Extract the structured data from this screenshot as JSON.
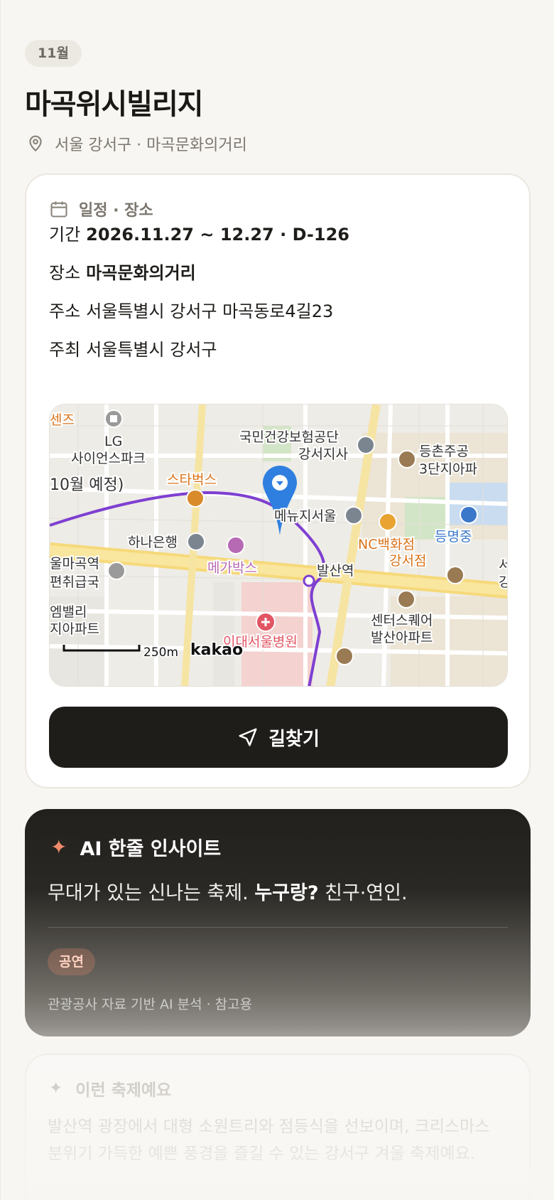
{
  "header": {
    "month": "11월",
    "title": "마곡위시빌리지",
    "location": "서울 강서구 · 마곡문화의거리"
  },
  "schedule": {
    "heading": "일정 · 장소",
    "period_label": "기간",
    "period_value": "2026.11.27 ~ 12.27 · D-126",
    "venue_label": "장소",
    "venue_value": "마곡문화의거리",
    "address_label": "주소",
    "address_value": "서울특별시 강서구 마곡동로4길23",
    "host_label": "주최",
    "host_value": "서울특별시 강서구"
  },
  "map": {
    "labels": {
      "lg1": "LG",
      "lg2": "사이언스파크",
      "topleft": "센즈",
      "oct": "10월 예정)",
      "starbucks": "스타벅스",
      "nhis1": "국민건강보험공단",
      "nhis2": "강서지사",
      "dc1": "등촌주공",
      "dc2": "3단지아파",
      "menuji": "메뉴지서울",
      "nc1": "NC백화점",
      "nc2": "강서점",
      "dm": "등명중",
      "hana": "하나은행",
      "mega": "메가박스",
      "balsan": "발산역",
      "ph1": "울마곡역",
      "ph2": "편취급국",
      "apt1": "엠밸리",
      "apt2": "지아파트",
      "center1": "센터스퀘어",
      "center2": "발산아파트",
      "hosp": "이대서울병원",
      "scale": "250m",
      "brand": "kakao",
      "edge1": "서",
      "edge2": "강"
    }
  },
  "directions_button": "길찾기",
  "ai": {
    "heading": "AI 한줄 인사이트",
    "line_plain": "무대가 있는 신나는 축제. ",
    "line_bold": "누구랑?",
    "line_tail": " 친구·연인.",
    "tag": "공연",
    "note": "관광공사 자료 기반 AI 분석 · 참고용"
  },
  "feature": {
    "heading": "이런 축제예요",
    "body": "발산역 광장에서 대형 소원트리와 점등식을 선보이며, 크리스마스 분위기 가득한 예쁜 풍경을 즐길 수 있는 강서구 겨울 축제예요."
  },
  "colors": {
    "accent": "#f08a6b",
    "dark": "#1f1d1a",
    "route": "#7e3fd1",
    "pin": "#2f7fe0"
  }
}
